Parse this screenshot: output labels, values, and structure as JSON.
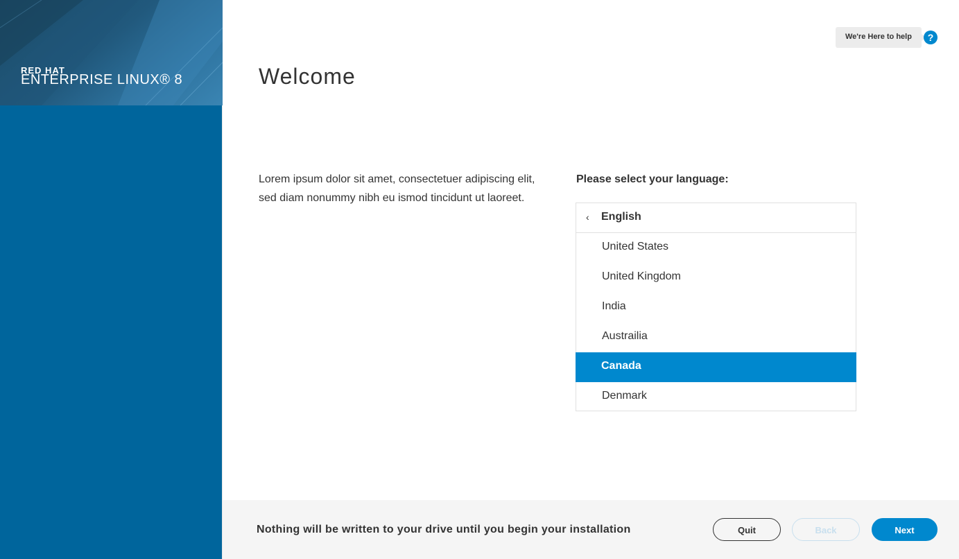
{
  "brand": {
    "line1": "RED HAT",
    "line2": "ENTERPRISE LINUX® 8"
  },
  "help": {
    "tooltip": "We're Here to help",
    "icon": "?"
  },
  "page": {
    "title": "Welcome",
    "intro": "Lorem ipsum dolor sit amet, consectetuer adipiscing elit, sed diam nonummy nibh eu ismod tincidunt ut laoreet."
  },
  "language": {
    "label": "Please select your language:",
    "group": "English",
    "group_chevron": "‹",
    "items": [
      "United States",
      "United Kingdom",
      "India",
      "Austrailia",
      "Canada",
      "Denmark"
    ],
    "selected": "Canada"
  },
  "footer": {
    "note": "Nothing will be written to your drive until you begin your installation",
    "quit_label": "Quit",
    "back_label": "Back",
    "next_label": "Next"
  },
  "colors": {
    "sidebar": "#00659c",
    "accent": "#0088ce",
    "footer_bg": "#f5f5f5"
  }
}
